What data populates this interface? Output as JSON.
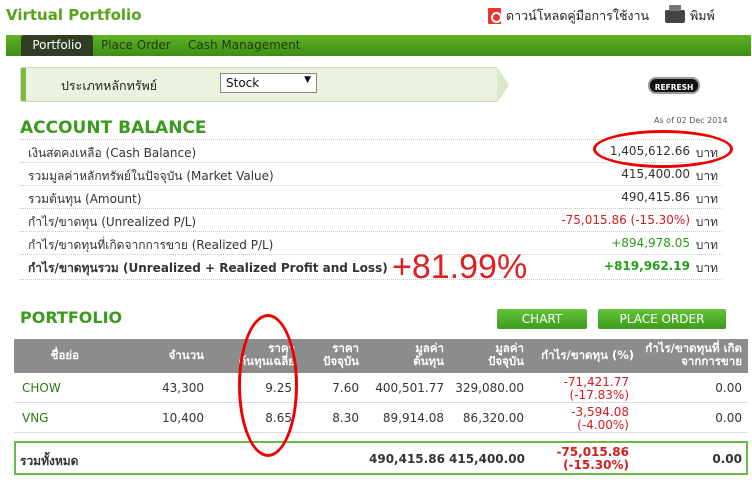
{
  "header": {
    "title": "Virtual Portfolio",
    "download_label": "ดาวน์โหลดคู่มือการใช้งาน",
    "print_label": "พิมพ์"
  },
  "tabs": [
    "Portfolio",
    "Place Order",
    "Cash Management"
  ],
  "filter": {
    "label": "ประเภทหลักทรัพย์",
    "selected": "Stock"
  },
  "refresh_label": "REFRESH",
  "account_balance": {
    "heading": "ACCOUNT BALANCE",
    "as_of": "As of 02 Dec 2014",
    "unit": "บาท",
    "rows": [
      {
        "label": "เงินสดคงเหลือ (Cash Balance)",
        "value": "1,405,612.66"
      },
      {
        "label": "รวมมูลค่าหลักทรัพย์ในปัจจุบัน (Market Value)",
        "value": "415,400.00"
      },
      {
        "label": "รวมต้นทุน (Amount)",
        "value": "490,415.86"
      },
      {
        "label": "กำไร/ขาดทุน (Unrealized P/L)",
        "value": "-75,015.86 (-15.30%)"
      },
      {
        "label": "กำไร/ขาดทุนที่เกิดจากการขาย (Realized P/L)",
        "value": "+894,978.05"
      },
      {
        "label": "กำไร/ขาดทุนรวม (Unrealized + Realized Profit and Loss)",
        "value": "+819,962.19"
      }
    ],
    "annotation": "+81.99%"
  },
  "portfolio": {
    "heading": "PORTFOLIO",
    "chart_button": "CHART",
    "order_button": "PLACE ORDER",
    "columns": [
      "ชื่อย่อ",
      "จำนวน",
      "ราคา ต้นทุนเฉลี่ย",
      "ราคา ปัจจุบัน",
      "มูลค่า ต้นทุน",
      "มูลค่า ปัจจุบัน",
      "กำไร/ขาดทุน (%)",
      "กำไร/ขาดทุนที่ เกิดจากการขาย"
    ],
    "rows": [
      {
        "symbol": "CHOW",
        "qty": "43,300",
        "avg_cost": "9.25",
        "price": "7.60",
        "cost_value": "400,501.77",
        "market_value": "329,080.00",
        "pl": "-71,421.77",
        "pl_pct": "(-17.83%)",
        "realized": "0.00"
      },
      {
        "symbol": "VNG",
        "qty": "10,400",
        "avg_cost": "8.65",
        "price": "8.30",
        "cost_value": "89,914.08",
        "market_value": "86,320.00",
        "pl": "-3,594.08",
        "pl_pct": "(-4.00%)",
        "realized": "0.00"
      }
    ],
    "total": {
      "label": "รวมทั้งหมด",
      "cost_value": "490,415.86",
      "market_value": "415,400.00",
      "pl": "-75,015.86",
      "pl_pct": "(-15.30%)",
      "realized": "0.00"
    }
  }
}
